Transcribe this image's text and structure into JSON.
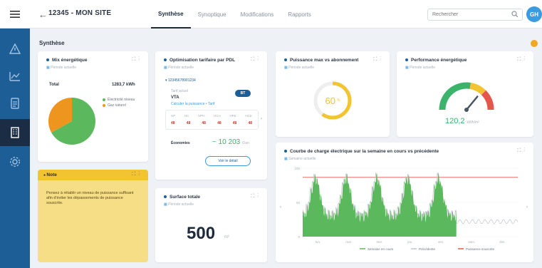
{
  "topbar": {
    "back_glyph": "←",
    "site_title": "12345 - MON SITE",
    "tabs": [
      {
        "label": "Synthèse"
      },
      {
        "label": "Synoptique"
      },
      {
        "label": "Modifications"
      },
      {
        "label": "Rapports"
      }
    ],
    "search_placeholder": "Rechercher",
    "avatar_initials": "GH"
  },
  "section": {
    "title": "Synthèse"
  },
  "cards": {
    "mix": {
      "title": "Mix énergétique",
      "subtitle": "Période actuelle",
      "total_label": "Total",
      "total_value": "1283,7 kWh",
      "legend": [
        "Électricité réseau",
        "Gaz naturel"
      ],
      "slices": [
        {
          "name": "Électricité réseau",
          "fraction": 0.67,
          "color": "#5cb85c"
        },
        {
          "name": "Gaz naturel",
          "fraction": 0.33,
          "color": "#ee9520"
        }
      ]
    },
    "optim": {
      "title": "Optimisation tarifaire par PDL",
      "subtitle": "Période actuelle",
      "pdl_label": "12345678901234",
      "tariff_title": "Tarif actuel",
      "tariff_value": "VTA",
      "tariff_link": "Calculer la puissance • Tarif",
      "badge": "BT",
      "table_headers": [
        "HP",
        "HC",
        "HPH",
        "HCH",
        "HPE",
        "HCE"
      ],
      "table_values": [
        "48",
        "48",
        "48",
        "48",
        "48",
        "48"
      ],
      "savings_label": "Économies",
      "savings_value": "~ 10 203",
      "savings_unit": "€/an",
      "button_label": "Voir le détail"
    },
    "surface": {
      "title": "Surface totale",
      "subtitle": "Période actuelle",
      "value": "500",
      "unit": "m²"
    },
    "puissance": {
      "title": "Puissance max vs abonnement",
      "subtitle": "Période actuelle",
      "value": "60",
      "unit": "%",
      "fraction": 0.6,
      "color": "#f3c432"
    },
    "perf": {
      "title": "Performance énergétique",
      "subtitle": "Période actuelle",
      "value": "120,2",
      "unit": "kWh/m²",
      "needle_fraction": 0.72
    },
    "courbe": {
      "title": "Courbe de charge électrique sur la semaine en cours vs précédente",
      "subtitle": "Semaine actuelle"
    }
  },
  "note": {
    "title": "Note",
    "text": "Pensez à rétablir un niveau de puissance suffisant afin d'éviter les dépassements de puissance souscrite."
  },
  "chart_data": {
    "type": "area",
    "title": "Courbe de charge électrique sur la semaine en cours vs précédente",
    "ylabel": "",
    "series": [
      {
        "name": "Semaine en cours",
        "color": "#5cb85c",
        "days": 5
      },
      {
        "name": "Précédente",
        "color": "#bfc5cc",
        "days": 7
      },
      {
        "name": "Puissance souscrite",
        "color": "#e4574b",
        "constant": 0.95
      }
    ],
    "legend": [
      "Semaine en cours",
      "Précédente",
      "Puissance souscrite"
    ],
    "x_ticks": [
      "lun.",
      "mar.",
      "mer.",
      "jeu.",
      "ven.",
      "sam.",
      "dim."
    ],
    "y_ticks": [
      "0",
      "50",
      "100"
    ]
  }
}
